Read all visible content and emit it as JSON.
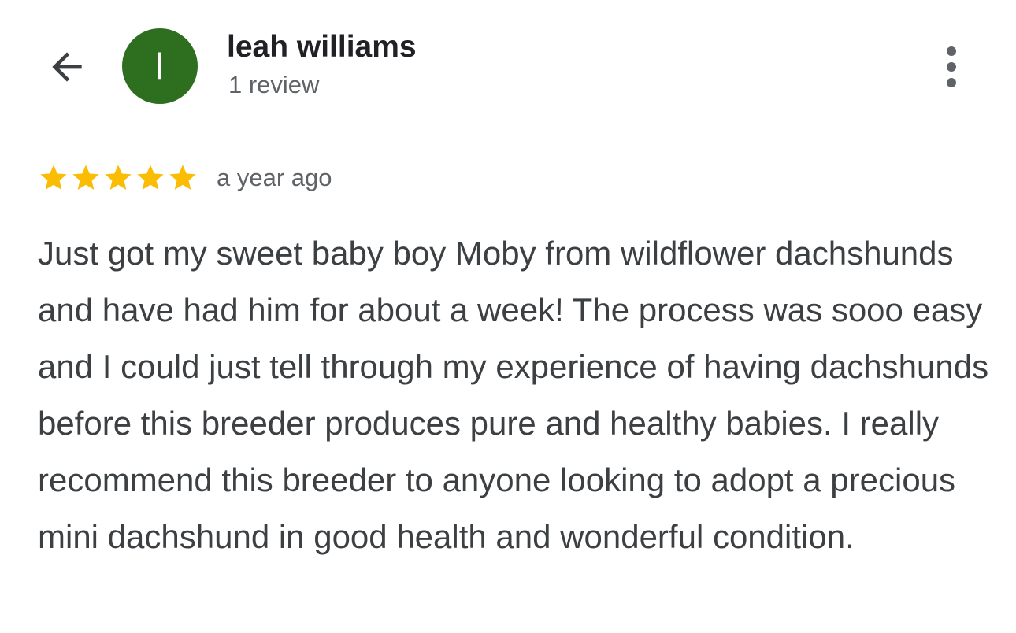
{
  "header": {
    "back_icon": "arrow-back-icon",
    "avatar_initial": "l",
    "avatar_color": "#2e6f1f",
    "user_name": "leah williams",
    "review_count": "1 review",
    "more_icon": "more-vert-icon"
  },
  "review": {
    "rating": 5,
    "max_rating": 5,
    "star_color": "#fbbc04",
    "timestamp": "a year ago",
    "text": "Just got my sweet baby boy Moby from wildflower dachshunds and have had him for about a week! The process was sooo easy and I could just tell through my experience of having dachshunds before this breeder produces pure and healthy babies. I really recommend this breeder to anyone looking to adopt a precious mini dachshund in good health and wonderful condition."
  }
}
